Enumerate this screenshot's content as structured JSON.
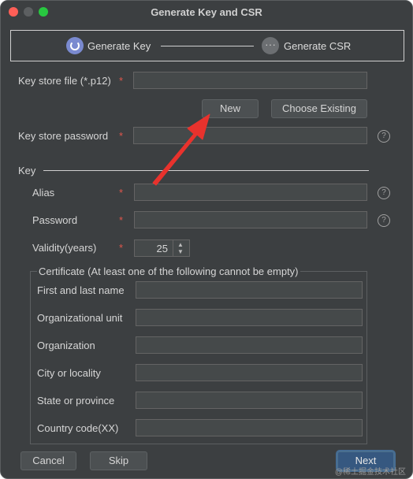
{
  "window": {
    "title": "Generate Key and CSR"
  },
  "steps": {
    "step1": {
      "label": "Generate Key",
      "icon": "loading-circle-icon",
      "color": "#7a8ad0"
    },
    "step2": {
      "label": "Generate CSR",
      "icon": "ellipsis-circle-icon",
      "glyph": "···"
    }
  },
  "form": {
    "keystore_file": {
      "label": "Key store file (*.p12)",
      "value": ""
    },
    "required_mark": "*",
    "new_button": "New",
    "choose_existing_button": "Choose Existing",
    "keystore_password": {
      "label": "Key store password",
      "value": ""
    },
    "help_glyph": "?"
  },
  "key_section": {
    "title": "Key",
    "alias": {
      "label": "Alias",
      "value": ""
    },
    "password": {
      "label": "Password",
      "value": ""
    },
    "validity": {
      "label": "Validity(years)",
      "value": "25"
    }
  },
  "certificate": {
    "title": "Certificate (At least one of the following cannot be empty)",
    "fields": [
      {
        "label": "First and last name",
        "value": ""
      },
      {
        "label": "Organizational unit",
        "value": ""
      },
      {
        "label": "Organization",
        "value": ""
      },
      {
        "label": "City or locality",
        "value": ""
      },
      {
        "label": "State or province",
        "value": ""
      },
      {
        "label": "Country code(XX)",
        "value": ""
      }
    ]
  },
  "footer": {
    "cancel_button": "Cancel",
    "skip_button": "Skip",
    "next_button": "Next"
  },
  "watermark": "@稀土掘金技术社区",
  "colors": {
    "background": "#3c3f41",
    "required": "#e0564c",
    "arrow": "#e8322d",
    "primary_button": "#365880"
  }
}
